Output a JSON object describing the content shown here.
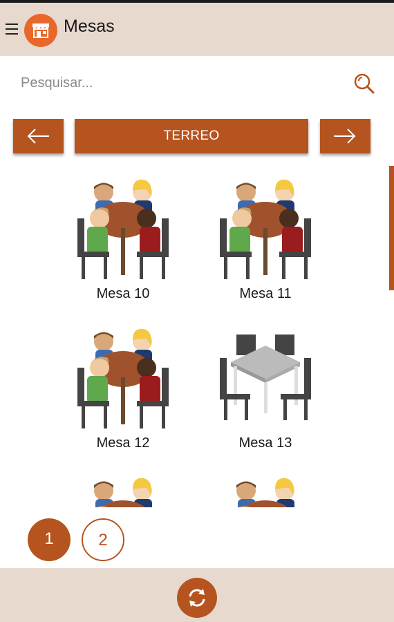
{
  "header": {
    "title": "Mesas",
    "menu_icon": "hamburger-menu-icon",
    "logo_icon": "store-icon"
  },
  "search": {
    "placeholder": "Pesquisar...",
    "icon": "search-icon"
  },
  "floor_nav": {
    "current": "TERREO",
    "prev_icon": "arrow-left-icon",
    "next_icon": "arrow-right-icon"
  },
  "tables": [
    {
      "label": "Mesa 10",
      "occupied": true
    },
    {
      "label": "Mesa 11",
      "occupied": true
    },
    {
      "label": "Mesa 12",
      "occupied": true
    },
    {
      "label": "Mesa 13",
      "occupied": false
    },
    {
      "label": "",
      "occupied": true
    },
    {
      "label": "",
      "occupied": true
    }
  ],
  "pagination": {
    "pages": [
      "1",
      "2"
    ],
    "active": "1"
  },
  "footer": {
    "refresh_icon": "refresh-icon"
  },
  "colors": {
    "accent": "#b5541f",
    "logo": "#e8682c",
    "bar_bg": "#e8d9cf"
  }
}
